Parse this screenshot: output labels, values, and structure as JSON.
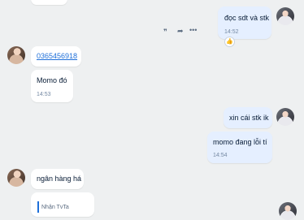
{
  "messages": [
    {
      "id": "m1",
      "text": "đọc sdt và stk",
      "time": "14:52"
    },
    {
      "id": "m2",
      "text": "0365456918"
    },
    {
      "id": "m3",
      "text": "Momo đó",
      "time": "14:53"
    },
    {
      "id": "m4",
      "text": "xin cái stk ik"
    },
    {
      "id": "m5",
      "text": "momo đang lỗi tí",
      "time": "14:54"
    },
    {
      "id": "m6",
      "text": "ngân hàng há"
    },
    {
      "id": "m7",
      "text": "Nhận TvTa"
    }
  ],
  "actions": {
    "quote_icon": "quote-icon",
    "forward_icon": "forward-icon",
    "more_icon": "more-icon",
    "like_icon": "thumbs-up-icon"
  },
  "colors": {
    "background": "#eef0f1",
    "my_bubble": "#e5efff",
    "their_bubble": "#ffffff",
    "link": "#1e6fd9",
    "time": "#7589a3"
  }
}
